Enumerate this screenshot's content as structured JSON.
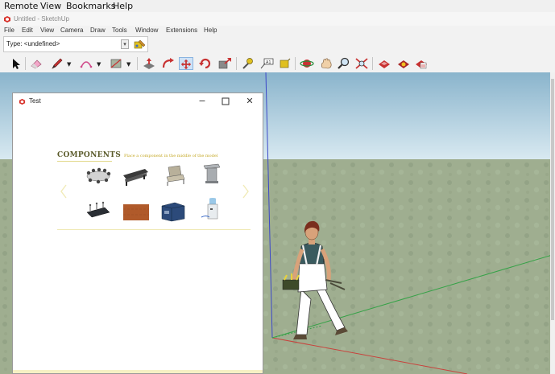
{
  "remote_menu": {
    "items": [
      "Remote",
      "View",
      "Bookmarks",
      "Help"
    ]
  },
  "window": {
    "title": "Untitled - SketchUp"
  },
  "menu": {
    "items": [
      "File",
      "Edit",
      "View",
      "Camera",
      "Draw",
      "Tools",
      "Window",
      "Extensions",
      "Help"
    ]
  },
  "entity_info": {
    "type_label": "Type: <undefined>"
  },
  "toolbar": {
    "tools": [
      "select-tool",
      "eraser-tool",
      "pencil-tool",
      "arc-tool",
      "shapes-tool",
      "push-pull-tool",
      "follow-me-tool",
      "move-tool",
      "rotate-tool",
      "scale-tool",
      "tape-measure-tool",
      "text-tool",
      "orbit-tool",
      "pan-tool",
      "zoom-tool",
      "zoom-extents-tool",
      "3d-warehouse",
      "extension-warehouse",
      "extension-manager"
    ],
    "active_tool": "move-tool"
  },
  "colors": {
    "sky_top": "#8fb8d0",
    "sky_bottom": "#d6e8f0",
    "ground": "#9aab8a",
    "axis_red": "#c8423c",
    "axis_green": "#35a247",
    "axis_blue": "#3b47c8"
  },
  "dialog": {
    "title": "Test",
    "heading": "COMPONENTS",
    "hint": "Place a component in the middle of the model",
    "components": [
      "conference-table",
      "office-chairs-row",
      "lounge-chair",
      "podium",
      "conference-setup",
      "wooden-board",
      "storage-box",
      "water-cooler"
    ]
  }
}
